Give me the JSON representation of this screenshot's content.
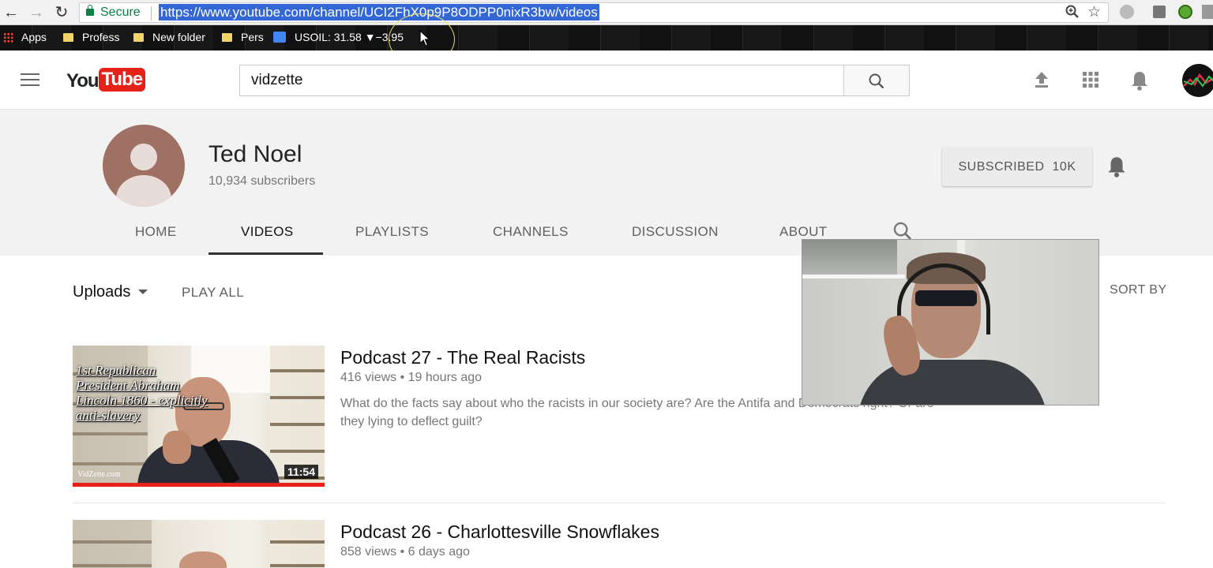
{
  "browser": {
    "secure_label": "Secure",
    "url": "https://www.youtube.com/channel/UCI2FhX0p9P8ODPP0nixR3bw/videos",
    "bookmarks": [
      {
        "label": "Apps",
        "icon": "apps-grid-icon"
      },
      {
        "label": "Profess",
        "icon": "folder-icon"
      },
      {
        "label": "New folder",
        "icon": "folder-icon"
      },
      {
        "label": "Pers",
        "icon": "folder-icon"
      },
      {
        "label": "USOIL: 31.58 ▼−3.95",
        "icon": "usoil-icon"
      }
    ]
  },
  "header": {
    "logo_you": "You",
    "logo_tube": "Tube",
    "search_value": "vidzette"
  },
  "channel": {
    "name": "Ted Noel",
    "subscribers": "10,934 subscribers",
    "subscribe_label": "SUBSCRIBED",
    "subscribe_count": "10K",
    "tabs": [
      "HOME",
      "VIDEOS",
      "PLAYLISTS",
      "CHANNELS",
      "DISCUSSION",
      "ABOUT"
    ],
    "active_tab": "VIDEOS"
  },
  "toolbar": {
    "uploads_label": "Uploads",
    "play_all_label": "PLAY ALL",
    "sort_by_label": "SORT BY"
  },
  "videos": [
    {
      "title": "Podcast 27 - The Real Racists",
      "meta": "416 views • 19 hours ago",
      "description": "What do the facts say about who the racists in our society are? Are the Antifa and Democrats right? Or are they lying to deflect guilt?",
      "duration": "11:54",
      "thumb_text": "1st Republican President Abraham Lincoln 1860 - explicitly anti-slavery",
      "watermark": "VidZette.com"
    },
    {
      "title": "Podcast 26 - Charlottesville Snowflakes",
      "meta": "858 views • 6 days ago"
    }
  ],
  "colors": {
    "youtube_red": "#e62117",
    "url_highlight": "#3367d6",
    "secure_green": "#0b8043"
  }
}
